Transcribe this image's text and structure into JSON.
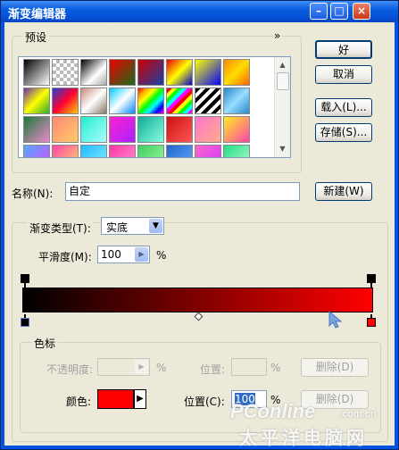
{
  "window": {
    "title": "渐变编辑器",
    "minimize_glyph": "–",
    "maximize_glyph": "□",
    "close_glyph": "×"
  },
  "presets": {
    "label": "预设",
    "menu_glyph": "»"
  },
  "buttons": {
    "ok": "好",
    "cancel": "取消",
    "load": "载入(L)...",
    "save": "存储(S)...",
    "new": "新建(W)",
    "delete": "删除(D)"
  },
  "name": {
    "label": "名称(N):",
    "value": "自定"
  },
  "gradient": {
    "type_label": "渐变类型(T):",
    "type_value": "实底",
    "smoothness_label": "平滑度(M):",
    "smoothness_value": "100",
    "percent": "%"
  },
  "color_stops": {
    "group_label": "色标",
    "opacity_label": "不透明度:",
    "opacity_value": "",
    "location_label": "位置:",
    "color_label": "颜色:",
    "color_location_label": "位置(C):",
    "color_location_value": "100",
    "color_value": "#ff0000"
  },
  "gradient_bar": {
    "start_color": "#000000",
    "end_color": "#ff0000"
  },
  "watermark": {
    "brand": "PConline",
    "suffix": ".com.cn",
    "cn": "太平洋电脑网"
  }
}
